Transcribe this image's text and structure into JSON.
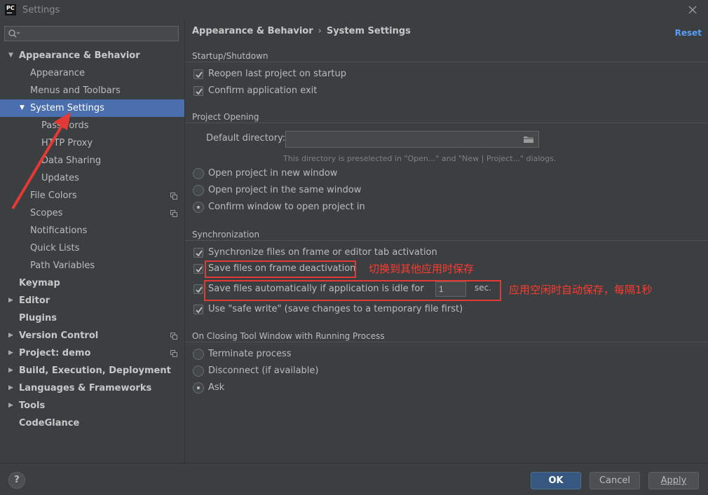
{
  "window": {
    "title": "Settings",
    "logo_text": "PC"
  },
  "search": {
    "placeholder": "",
    "value": ""
  },
  "sidebar": {
    "items": [
      {
        "label": "Appearance & Behavior",
        "arrow": "▼"
      },
      {
        "label": "Appearance"
      },
      {
        "label": "Menus and Toolbars"
      },
      {
        "label": "System Settings",
        "arrow": "▼",
        "selected": true
      },
      {
        "label": "Passwords"
      },
      {
        "label": "HTTP Proxy"
      },
      {
        "label": "Data Sharing"
      },
      {
        "label": "Updates"
      },
      {
        "label": "File Colors"
      },
      {
        "label": "Scopes"
      },
      {
        "label": "Notifications"
      },
      {
        "label": "Quick Lists"
      },
      {
        "label": "Path Variables"
      },
      {
        "label": "Keymap"
      },
      {
        "label": "Editor",
        "arrow": "▶"
      },
      {
        "label": "Plugins"
      },
      {
        "label": "Version Control",
        "arrow": "▶"
      },
      {
        "label": "Project: demo",
        "arrow": "▶"
      },
      {
        "label": "Build, Execution, Deployment",
        "arrow": "▶"
      },
      {
        "label": "Languages & Frameworks",
        "arrow": "▶"
      },
      {
        "label": "Tools",
        "arrow": "▶"
      },
      {
        "label": "CodeGlance"
      }
    ]
  },
  "header": {
    "breadcrumb_parent": "Appearance & Behavior",
    "breadcrumb_sep": "›",
    "breadcrumb_current": "System Settings",
    "reset_label": "Reset"
  },
  "startup": {
    "title": "Startup/Shutdown",
    "reopen_label": "Reopen last project on startup",
    "reopen_checked": true,
    "confirm_exit_label": "Confirm application exit",
    "confirm_exit_checked": true
  },
  "project_opening": {
    "title": "Project Opening",
    "default_dir_label": "Default directory:",
    "default_dir_value": "",
    "hint": "This directory is preselected in \"Open...\" and \"New | Project...\" dialogs.",
    "options": [
      "Open project in new window",
      "Open project in the same window",
      "Confirm window to open project in"
    ],
    "selected_option": "Confirm window to open project in"
  },
  "sync": {
    "title": "Synchronization",
    "sync_files_label": "Synchronize files on frame or editor tab activation",
    "save_deactivation_label": "Save files on frame deactivation",
    "save_idle_label": "Save files automatically if application is idle for",
    "idle_seconds": "1",
    "sec_label": "sec.",
    "safe_write_label": "Use \"safe write\" (save changes to a temporary file first)"
  },
  "closing_tool": {
    "title": "On Closing Tool Window with Running Process",
    "options": [
      "Terminate process",
      "Disconnect (if available)",
      "Ask"
    ],
    "selected_option": "Ask"
  },
  "annotations": {
    "note_deactivation": "切换到其他应用时保存",
    "note_idle": "应用空闲时自动保存，每隔1秒",
    "color": "#ff3b30"
  },
  "footer": {
    "help_label": "?",
    "ok_label": "OK",
    "cancel_label": "Cancel",
    "apply_label": "Apply"
  },
  "colors": {
    "background": "#3c3f41",
    "selection": "#4b6eaf",
    "link": "#589df6",
    "primary_button": "#365880"
  }
}
